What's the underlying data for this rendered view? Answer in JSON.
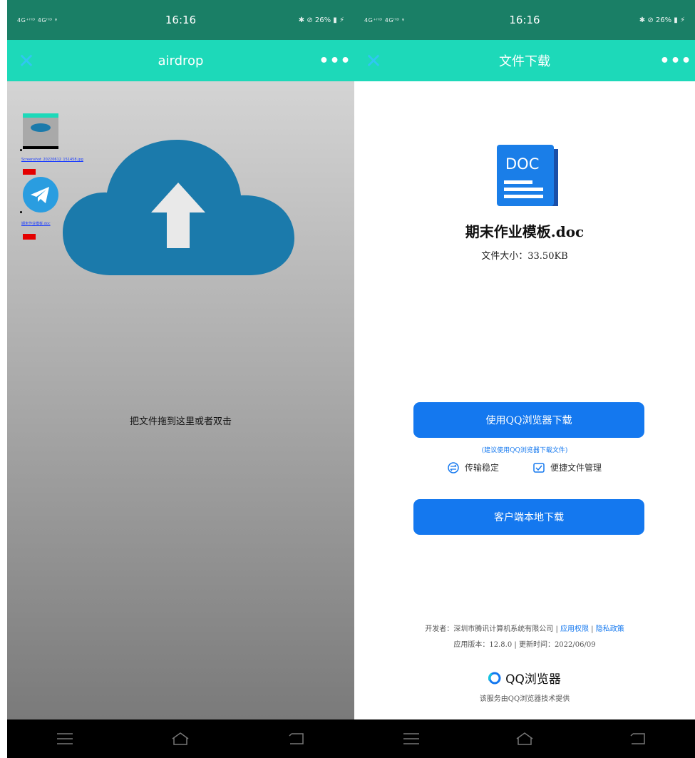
{
  "left": {
    "status": {
      "signal": "4G⁺ᴴᴰ 4Gᴴᴰ ᵠ",
      "time": "16:16",
      "right": "✱ ⊘ 26% ▮ ⚡"
    },
    "title": "airdrop",
    "more": "•••",
    "close": "✕",
    "files": [
      {
        "name": "Screenshot_20220612_151458.jpg",
        "thumb": "screenshot-thumb"
      },
      {
        "name": "期末作业模板.doc",
        "thumb": "telegram-logo"
      }
    ],
    "drop_hint": "把文件拖到这里或者双击"
  },
  "right": {
    "status": {
      "signal": "4G⁺ᴴᴰ 4Gᴴᴰ ᵠ",
      "time": "16:16",
      "right": "✱ ⊘ 26% ▮ ⚡"
    },
    "title": "文件下载",
    "more": "•••",
    "close": "✕",
    "doc_label": "DOC",
    "file_name": "期末作业模板.doc",
    "file_size": "文件大小：33.50KB",
    "btn_qq": "使用QQ浏览器下载",
    "suggest": "(建议使用QQ浏览器下载文件)",
    "feature1": "传输稳定",
    "feature2": "便捷文件管理",
    "btn_local": "客户端本地下载",
    "developer": "开发者：深圳市腾讯计算机系统有限公司",
    "sep": " | ",
    "perm": "应用权限",
    "privacy": "隐私政策",
    "version": "应用版本：12.8.0 | 更新时间：2022/06/09",
    "brand": "QQ浏览器",
    "provided": "该服务由QQ浏览器技术提供"
  },
  "colors": {
    "accent": "#1dd9b9",
    "button": "#1478ef",
    "cloud": "#1b7aab"
  }
}
